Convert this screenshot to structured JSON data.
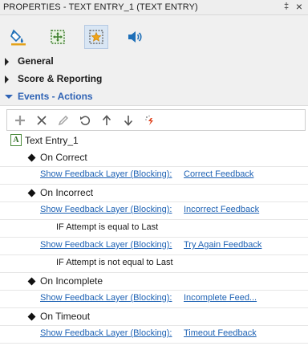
{
  "panel": {
    "title": "PROPERTIES - TEXT ENTRY_1 (TEXT ENTRY)",
    "pin_glyph": "‡",
    "close_glyph": "×"
  },
  "tabs": [
    {
      "icon": "paint-bucket-icon",
      "active": false
    },
    {
      "icon": "size-position-icon",
      "active": false
    },
    {
      "icon": "star-effects-icon",
      "active": true
    },
    {
      "icon": "audio-icon",
      "active": false
    }
  ],
  "sections": {
    "general": "General",
    "score": "Score & Reporting",
    "events": "Events - Actions"
  },
  "toolbar": [
    "add-icon",
    "delete-icon",
    "edit-icon",
    "undo-icon",
    "move-up-icon",
    "move-down-icon",
    "magic-icon"
  ],
  "tree": {
    "root": "Text Entry_1",
    "root_icon_letter": "A",
    "events": {
      "correct": "On Correct",
      "incorrect": "On Incorrect",
      "incomplete": "On Incomplete",
      "timeout": "On Timeout"
    },
    "action_label": "Show Feedback Layer (Blocking):",
    "targets": {
      "correct": "Correct Feedback",
      "incorrect": "Incorrect Feedback",
      "try_again": "Try Again Feedback",
      "incomplete": "Incomplete Feed...",
      "timeout": "Timeout Feedback"
    },
    "conditions": {
      "equal": "IF Attempt is equal to Last",
      "not_equal": "IF Attempt is not equal to Last"
    }
  },
  "colors": {
    "link": "#1e62b4",
    "section_open": "#2f63b5",
    "active_tab": "#d9e6f4",
    "panel_bg": "#f0f0f0"
  }
}
